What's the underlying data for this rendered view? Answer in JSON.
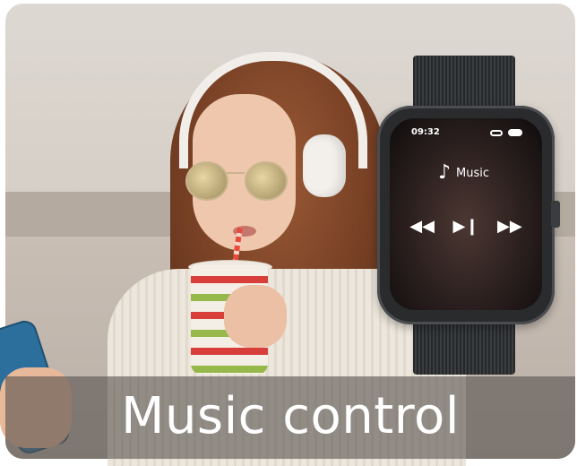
{
  "watch": {
    "time": "09:32",
    "app_label": "Music",
    "icons": [
      "link-icon",
      "battery-icon",
      "music-note-icon",
      "previous-track-icon",
      "play-pause-icon",
      "next-track-icon"
    ]
  },
  "caption": {
    "text": "Music control"
  }
}
